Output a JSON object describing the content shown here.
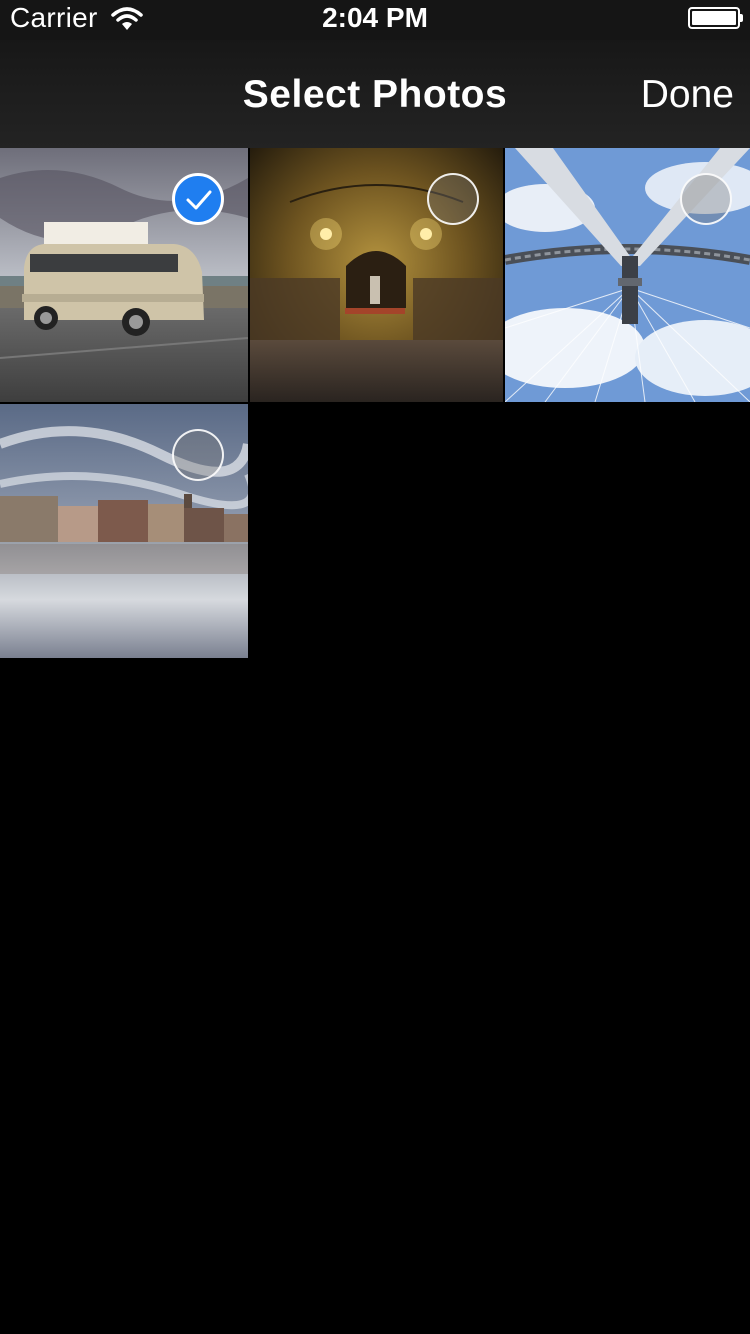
{
  "status_bar": {
    "carrier": "Carrier",
    "time": "2:04 PM",
    "icons": [
      "wifi-icon",
      "battery-icon"
    ]
  },
  "nav_bar": {
    "title": "Select Photos",
    "done_label": "Done"
  },
  "photos": [
    {
      "subject": "camper van",
      "selected": true
    },
    {
      "subject": "chapel interior",
      "selected": false
    },
    {
      "subject": "ferris wheel",
      "selected": false
    },
    {
      "subject": "flooded town",
      "selected": false
    }
  ],
  "colors": {
    "selection_accent": "#1f7ef0",
    "background": "#000000",
    "nav_bar": "#1c1c1c"
  }
}
